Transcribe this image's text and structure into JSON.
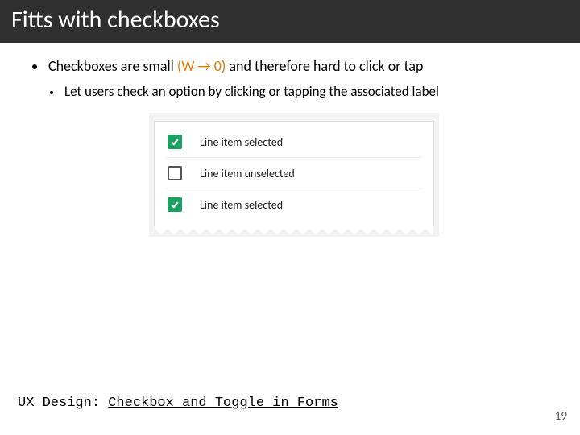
{
  "title": "Fitts with checkboxes",
  "bullet_main_a": "Checkboxes ",
  "bullet_main_b": "are small ",
  "bullet_main_accent": "(W → 0)",
  "bullet_main_c": " and therefore hard to click or tap",
  "bullet_sub": "Let users check an option by clicking or tapping the associated label",
  "rows": {
    "r0": "Line item selected",
    "r1": "Line item unselected",
    "r2": "Line item selected"
  },
  "footer_prefix": "UX Design: ",
  "footer_link": "Checkbox and Toggle in Forms",
  "page_number": "19"
}
